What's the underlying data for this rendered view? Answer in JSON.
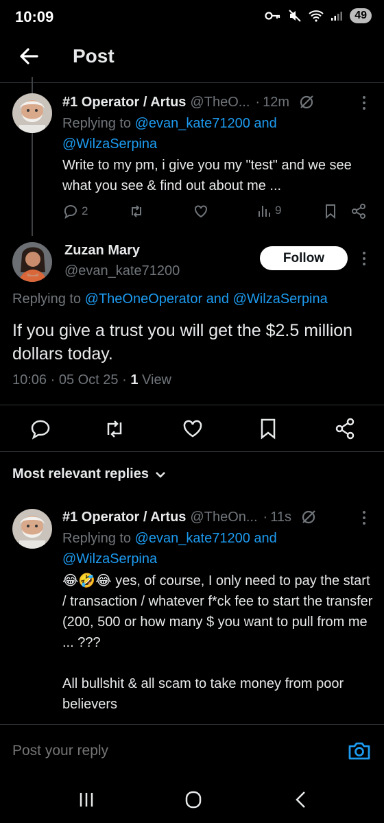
{
  "status_bar": {
    "time": "10:09",
    "battery": "49",
    "icons": [
      "key-icon",
      "mute-icon",
      "wifi-icon",
      "signal-icon",
      "battery-icon"
    ]
  },
  "header": {
    "title": "Post",
    "back_icon": "arrow-left-icon"
  },
  "parent_tweet": {
    "name": "#1 Operator / Artus",
    "handle": "@TheO...",
    "dot": "·",
    "time": "12m",
    "replying_prefix": "Replying to",
    "mention_1": "@evan_kate71200",
    "and": "and",
    "mention_2": "@WilzaSerpina",
    "text": "Write to my pm, i give you my \"test\" and we see what you see & find out about me ...",
    "replies": "2",
    "views": "9"
  },
  "main_tweet": {
    "name": "Zuzan Mary",
    "handle": "@evan_kate71200",
    "follow_label": "Follow",
    "replying_prefix": "Replying to",
    "mention_1": "@TheOneOperator",
    "and": "and",
    "mention_2": "@WilzaSerpina",
    "text": "If you give a trust you will get the $2.5 million dollars today.",
    "timestamp": "10:06 · 05 Oct 25 ·",
    "view_count": "1",
    "view_label": "View"
  },
  "replies_section": {
    "sort_label": "Most relevant replies"
  },
  "reply_tweet": {
    "name": "#1 Operator / Artus",
    "handle": "@TheOn...",
    "dot": "·",
    "time": "11s",
    "replying_prefix": "Replying to",
    "mention_1": "@evan_kate71200",
    "and": "and",
    "mention_2": "@WilzaSerpina",
    "text": "😂🤣😂 yes, of course, I only need to pay the start / transaction / whatever f*ck fee to start the transfer (200, 500 or how many $ you want to pull from me  ... ???\n\nAll bullshit & all scam to take money from poor believers"
  },
  "composer": {
    "placeholder": "Post your reply"
  },
  "colors": {
    "background": "#000000",
    "text_primary": "#e7e9ea",
    "text_secondary": "#71767b",
    "accent": "#1d9bf0",
    "divider": "#2f3336"
  }
}
